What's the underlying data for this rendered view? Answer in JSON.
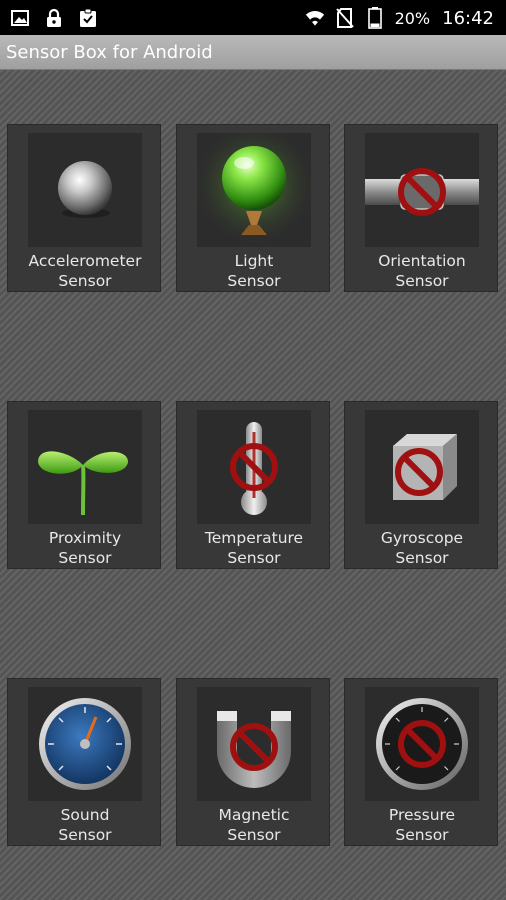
{
  "status_bar": {
    "icons_left": [
      "image-icon",
      "lock-icon",
      "clipboard-check-icon"
    ],
    "icons_right": [
      "wifi-icon",
      "no-sim-icon",
      "battery-icon"
    ],
    "battery": "20%",
    "time": "16:42"
  },
  "app": {
    "title": "Sensor Box for Android"
  },
  "sensors": [
    {
      "line1": "Accelerometer",
      "line2": "Sensor",
      "icon": "metal-ball-icon",
      "available": true
    },
    {
      "line1": "Light",
      "line2": "Sensor",
      "icon": "green-bulb-icon",
      "available": true
    },
    {
      "line1": "Orientation",
      "line2": "Sensor",
      "icon": "level-icon",
      "available": false
    },
    {
      "line1": "Proximity",
      "line2": "Sensor",
      "icon": "sprout-icon",
      "available": true
    },
    {
      "line1": "Temperature",
      "line2": "Sensor",
      "icon": "thermometer-icon",
      "available": false
    },
    {
      "line1": "Gyroscope",
      "line2": "Sensor",
      "icon": "cube-icon",
      "available": false
    },
    {
      "line1": "Sound",
      "line2": "Sensor",
      "icon": "blue-gauge-icon",
      "available": true
    },
    {
      "line1": "Magnetic",
      "line2": "Sensor",
      "icon": "magnet-icon",
      "available": false
    },
    {
      "line1": "Pressure",
      "line2": "Sensor",
      "icon": "pressure-gauge-icon",
      "available": false
    }
  ],
  "colors": {
    "background": "#5a5a5a",
    "tile": "#383838",
    "title_bar": "#aaaaaa",
    "unavailable_mark": "#a01010",
    "light_green": "#6fdc2a",
    "sound_blue": "#1d4f8a"
  }
}
